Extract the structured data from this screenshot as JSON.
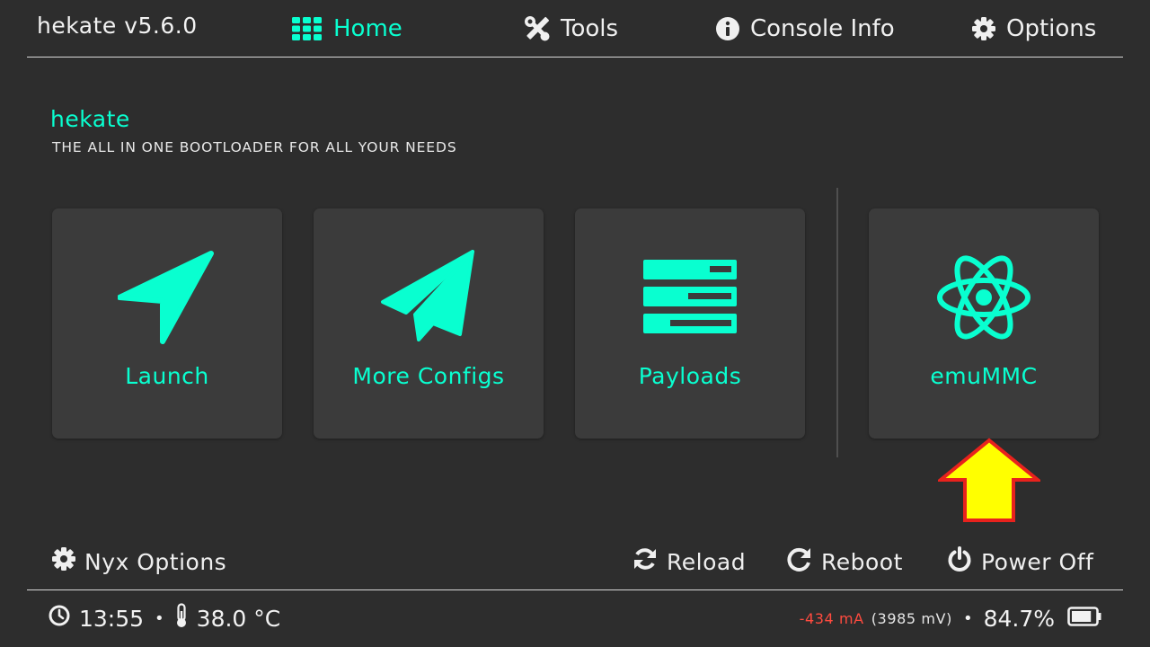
{
  "header": {
    "title": "hekate v5.6.0",
    "tabs": [
      {
        "label": "Home",
        "icon": "grid-icon",
        "active": true
      },
      {
        "label": "Tools",
        "icon": "tools-icon",
        "active": false
      },
      {
        "label": "Console Info",
        "icon": "info-icon",
        "active": false
      },
      {
        "label": "Options",
        "icon": "gear-icon",
        "active": false
      }
    ]
  },
  "hero": {
    "title": "hekate",
    "subtitle": "THE ALL IN ONE BOOTLOADER FOR ALL YOUR NEEDS"
  },
  "tiles": [
    {
      "label": "Launch",
      "icon": "navigation-arrow-icon"
    },
    {
      "label": "More Configs",
      "icon": "paper-plane-icon"
    },
    {
      "label": "Payloads",
      "icon": "server-stack-icon"
    },
    {
      "label": "emuMMC",
      "icon": "atom-icon"
    }
  ],
  "footer_actions": {
    "nyx_options": "Nyx Options",
    "reload": "Reload",
    "reboot": "Reboot",
    "power_off": "Power Off"
  },
  "status": {
    "time": "13:55",
    "temperature": "38.0 °C",
    "current": "-434 mA",
    "voltage": "(3985 mV)",
    "battery": "84.7%",
    "battery_level": 0.847
  },
  "colors": {
    "accent": "#09ffd0",
    "background": "#2d2d2d",
    "tile": "#3b3b3b",
    "current_negative": "#ff4b3f",
    "annotation_arrow_fill": "#ffff00",
    "annotation_arrow_stroke": "#e8221d"
  }
}
